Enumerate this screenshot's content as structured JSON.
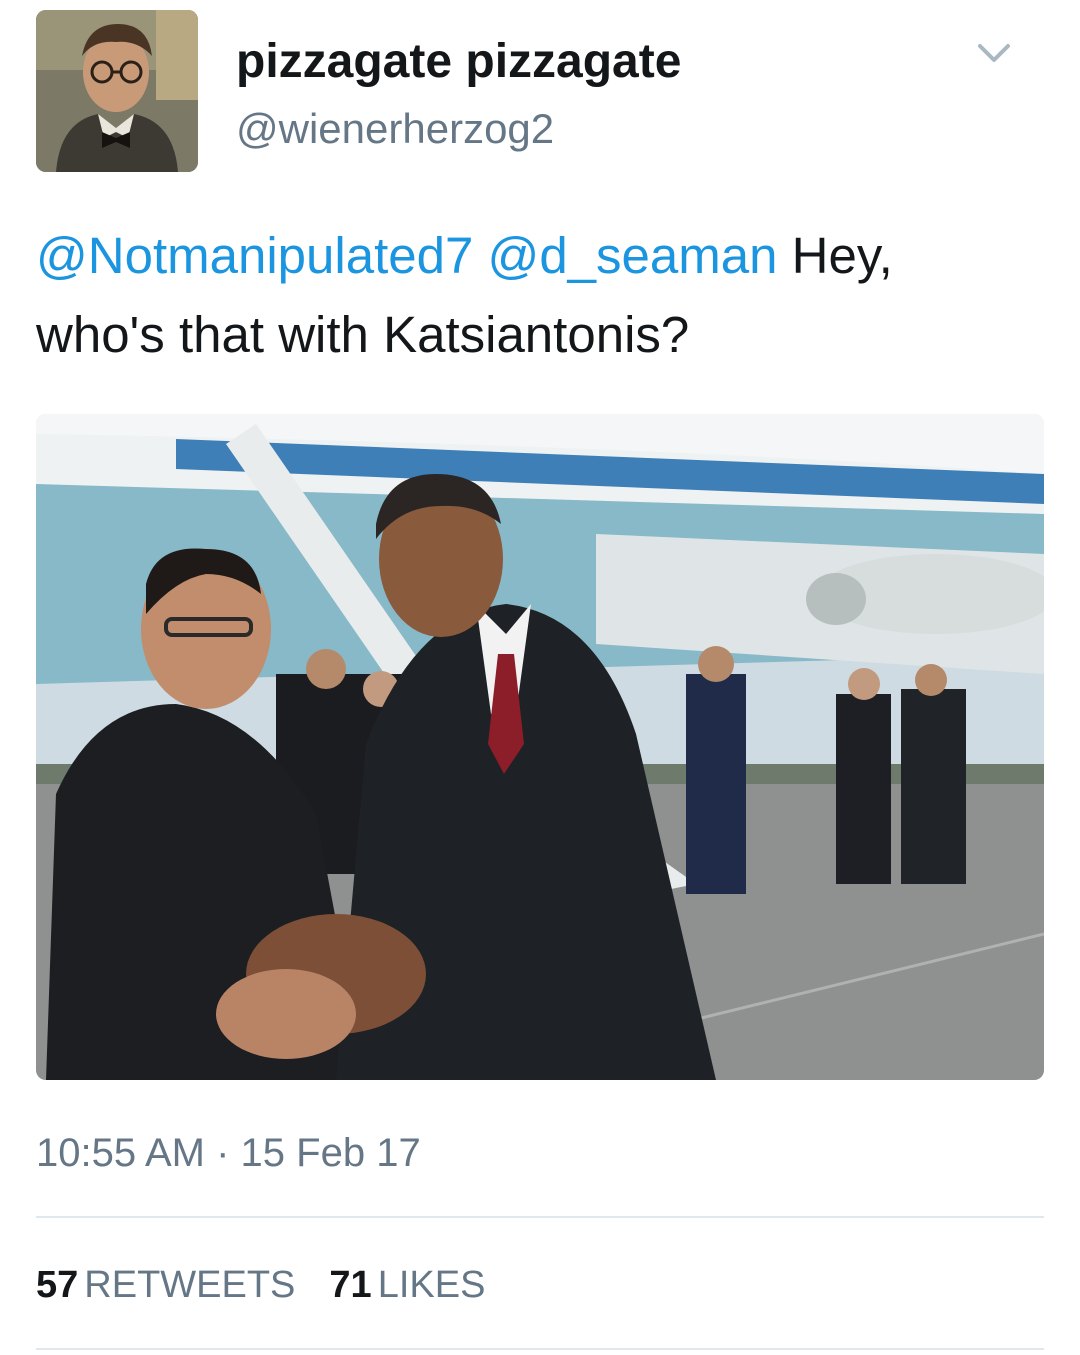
{
  "tweet": {
    "author": {
      "display_name": "pizzagate pizzagate",
      "handle": "@wienerherzog2",
      "avatar_icon": "user-avatar"
    },
    "menu_icon": "chevron-down-icon",
    "text": {
      "mention_1": "@Notmanipulated7",
      "mention_2": "@d_seaman",
      "body_line_1": " Hey,",
      "body_line_2": "who's that with Katsiantonis?"
    },
    "timestamp": "10:55 AM · 15 Feb 17",
    "stats": {
      "retweets_count": "57",
      "retweets_label": "RETWEETS",
      "likes_count": "71",
      "likes_label": "LIKES"
    }
  },
  "colors": {
    "link": "#1b95e0",
    "secondary_text": "#657786",
    "primary_text": "#14171a",
    "divider": "#e1e8ed"
  }
}
